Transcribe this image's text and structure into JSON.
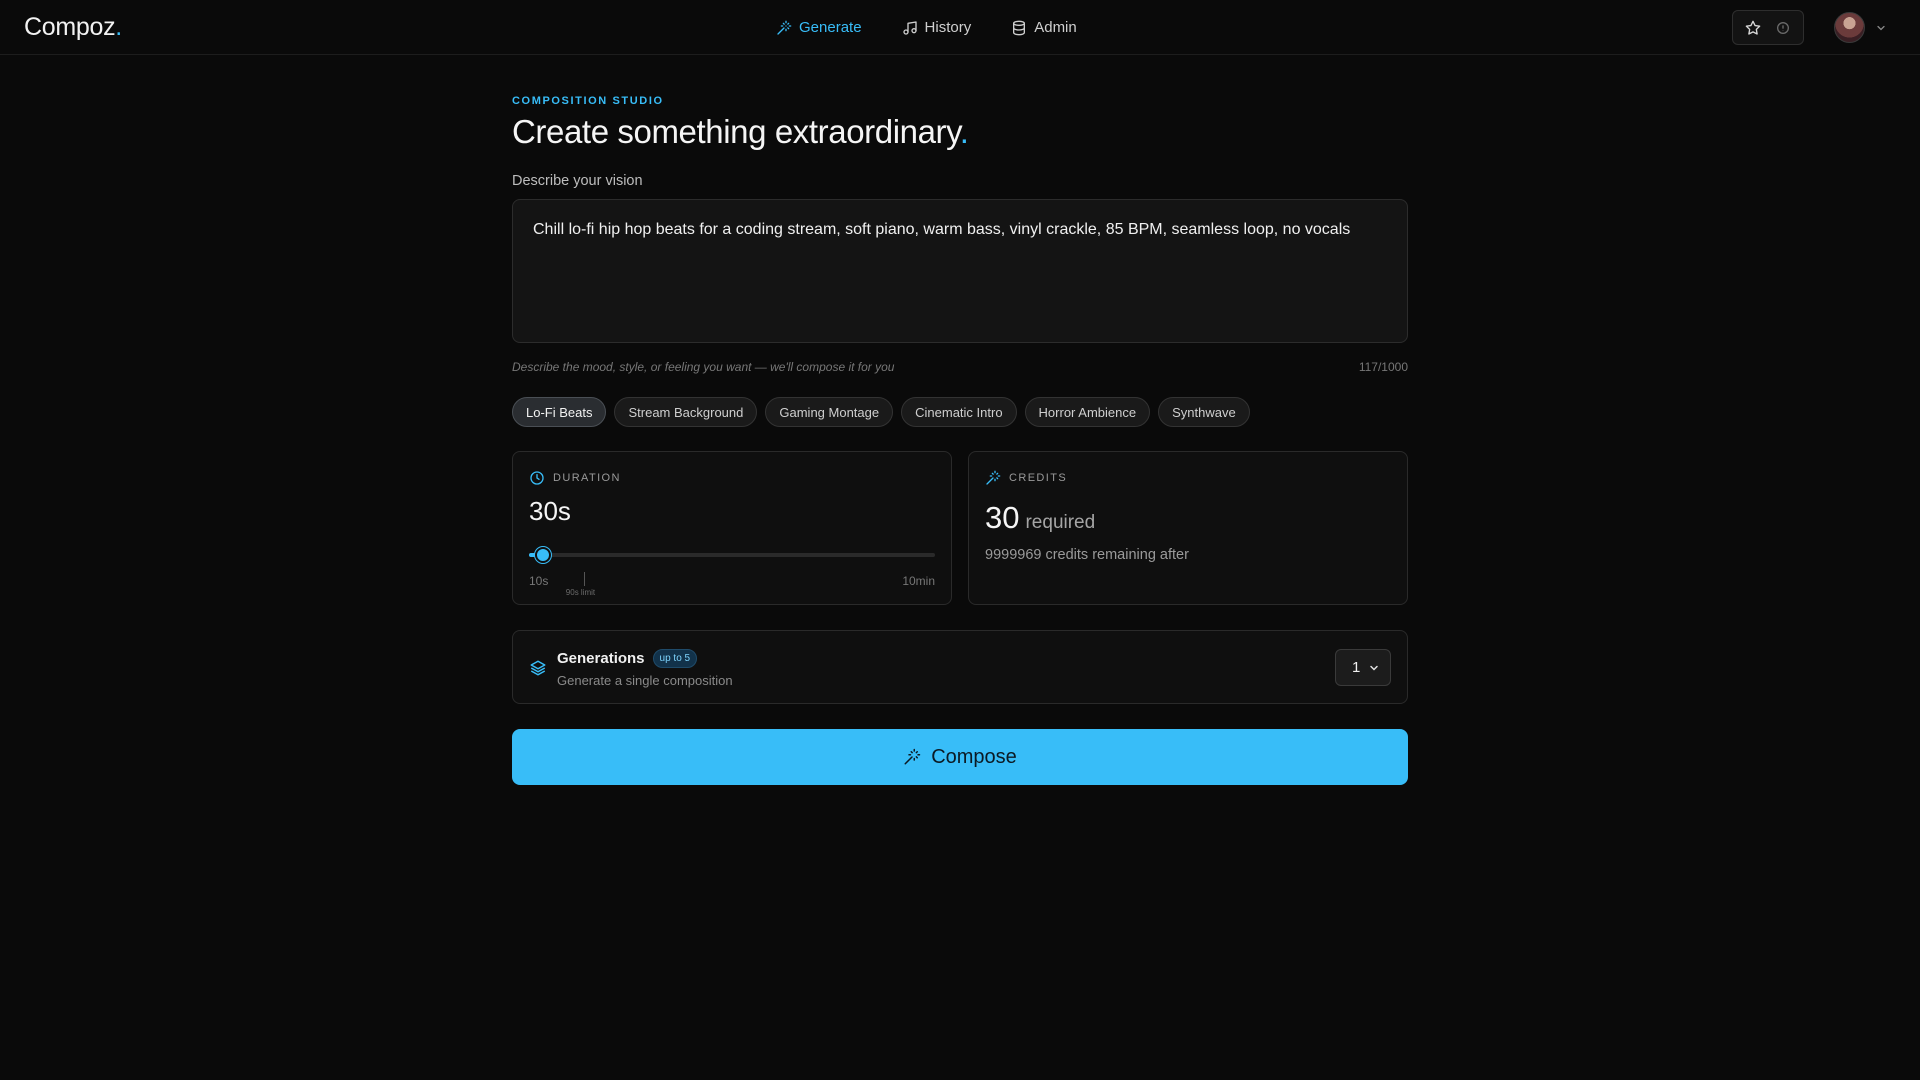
{
  "brand": {
    "name": "Compoz",
    "dot": "."
  },
  "nav": [
    {
      "label": "Generate",
      "icon": "wand-icon",
      "active": true
    },
    {
      "label": "History",
      "icon": "music-note-icon",
      "active": false
    },
    {
      "label": "Admin",
      "icon": "database-icon",
      "active": false
    }
  ],
  "header_actions": {
    "icons": [
      "star-icon",
      "info-icon"
    ]
  },
  "user": {
    "avatar": "user-avatar",
    "menu_icon": "chevron-down-icon"
  },
  "studio": {
    "eyebrow": "COMPOSITION STUDIO",
    "title": "Create something extraordinary",
    "title_dot": "."
  },
  "prompt": {
    "label": "Describe your vision",
    "value": "Chill lo-fi hip hop beats for a coding stream, soft piano, warm bass, vinyl crackle, 85 BPM, seamless loop, no vocals",
    "hint": "Describe the mood, style, or feeling you want — we'll compose it for you",
    "counter": "117/1000"
  },
  "presets": [
    {
      "label": "Lo-Fi Beats",
      "active": true
    },
    {
      "label": "Stream Background",
      "active": false
    },
    {
      "label": "Gaming Montage",
      "active": false
    },
    {
      "label": "Cinematic Intro",
      "active": false
    },
    {
      "label": "Horror Ambience",
      "active": false
    },
    {
      "label": "Synthwave",
      "active": false
    }
  ],
  "duration": {
    "label": "DURATION",
    "value": "30s",
    "min_label": "10s",
    "max_label": "10min",
    "limit_label": "90s limit",
    "slider_fraction": 0.034,
    "limit_fraction": 0.135
  },
  "credits": {
    "label": "CREDITS",
    "value": "30",
    "suffix": "required",
    "remaining": "9999969 credits remaining after"
  },
  "generations": {
    "title": "Generations",
    "badge": "up to 5",
    "subtitle": "Generate a single composition",
    "selected": "1"
  },
  "compose": {
    "label": "Compose"
  },
  "colors": {
    "accent": "#38bdf8",
    "background": "#0a0a0a",
    "card": "#0f0f0f"
  }
}
